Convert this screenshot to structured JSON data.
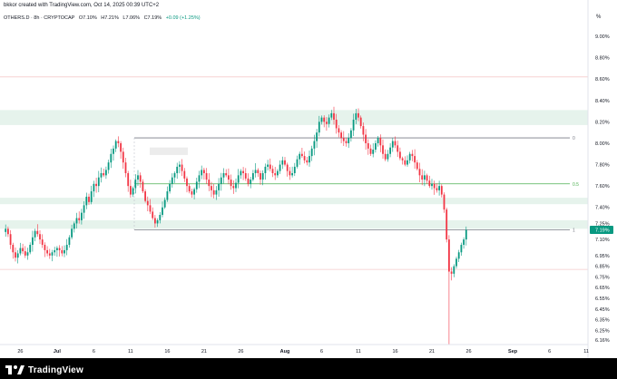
{
  "header": {
    "text": "bkkor created with TradingView.com, Oct 14, 2025 00:39 UTC+2"
  },
  "symbol": {
    "name": "OTHERS.D · 8h · CRYPTOCAP",
    "open": "O7.10%",
    "high": "H7.21%",
    "low": "L7.06%",
    "close": "C7.19%",
    "change": "+0.09 (+1.25%)"
  },
  "axis": {
    "unit": "%"
  },
  "footer": {
    "brand": "TradingView"
  },
  "chart_data": {
    "type": "candlestick",
    "title": "",
    "xlabel": "",
    "ylabel": "",
    "ylim": [
      6.1,
      9.1
    ],
    "y_ticks": [
      "9.00%",
      "8.80%",
      "8.60%",
      "8.40%",
      "8.20%",
      "8.00%",
      "7.80%",
      "7.60%",
      "7.40%",
      "7.25%",
      "7.10%",
      "6.95%",
      "6.85%",
      "6.75%",
      "6.65%",
      "6.55%",
      "6.45%",
      "6.35%",
      "6.25%",
      "6.16%"
    ],
    "current_price_label": "7.19%",
    "x_ticks": [
      "26",
      "Jul",
      "6",
      "11",
      "16",
      "21",
      "26",
      "Aug",
      "6",
      "11",
      "16",
      "21",
      "26",
      "Sep",
      "6",
      "11",
      "16",
      "21",
      "26",
      "Oct",
      "6",
      "11",
      "16",
      "21"
    ],
    "bars_per_day": 3,
    "first_bar_date": "2025-06-24",
    "fib_levels": [
      {
        "label": "0",
        "value": 8.05
      },
      {
        "label": "0.5",
        "value": 7.62
      },
      {
        "label": "1",
        "value": 7.19
      }
    ],
    "zones": [
      {
        "from": 8.17,
        "to": 8.31
      },
      {
        "from": 7.43,
        "to": 7.49
      },
      {
        "from": 7.2,
        "to": 7.28
      }
    ],
    "horizontal_levels": [
      8.62,
      6.82
    ],
    "closes": [
      7.2,
      7.15,
      7.05,
      6.98,
      6.93,
      6.97,
      7.02,
      6.99,
      6.95,
      6.98,
      7.05,
      7.12,
      7.18,
      7.15,
      7.1,
      7.05,
      7.0,
      6.97,
      6.95,
      6.98,
      7.0,
      7.02,
      7.0,
      6.97,
      7.0,
      7.05,
      7.12,
      7.2,
      7.25,
      7.3,
      7.28,
      7.35,
      7.42,
      7.5,
      7.45,
      7.55,
      7.62,
      7.6,
      7.68,
      7.72,
      7.7,
      7.75,
      7.82,
      7.9,
      7.95,
      8.02,
      8.0,
      7.92,
      7.82,
      7.72,
      7.6,
      7.52,
      7.58,
      7.66,
      7.7,
      7.64,
      7.55,
      7.46,
      7.42,
      7.36,
      7.3,
      7.25,
      7.28,
      7.33,
      7.4,
      7.47,
      7.55,
      7.62,
      7.68,
      7.72,
      7.78,
      7.8,
      7.74,
      7.67,
      7.6,
      7.55,
      7.52,
      7.57,
      7.64,
      7.7,
      7.75,
      7.72,
      7.66,
      7.6,
      7.56,
      7.52,
      7.56,
      7.62,
      7.68,
      7.72,
      7.7,
      7.66,
      7.6,
      7.58,
      7.63,
      7.7,
      7.74,
      7.72,
      7.67,
      7.62,
      7.66,
      7.72,
      7.75,
      7.72,
      7.66,
      7.72,
      7.78,
      7.8,
      7.76,
      7.72,
      7.7,
      7.74,
      7.8,
      7.84,
      7.8,
      7.74,
      7.7,
      7.72,
      7.78,
      7.85,
      7.9,
      7.88,
      7.84,
      7.82,
      7.88,
      7.95,
      8.02,
      8.1,
      8.2,
      8.24,
      8.2,
      8.18,
      8.24,
      8.28,
      8.22,
      8.14,
      8.1,
      8.05,
      8.02,
      8.0,
      8.05,
      8.12,
      8.22,
      8.28,
      8.24,
      8.16,
      8.08,
      8.0,
      7.95,
      7.9,
      7.94,
      8.0,
      8.05,
      7.98,
      7.9,
      7.85,
      7.9,
      7.96,
      8.02,
      7.98,
      7.92,
      7.86,
      7.84,
      7.8,
      7.84,
      7.9,
      7.88,
      7.82,
      7.76,
      7.7,
      7.66,
      7.7,
      7.65,
      7.6,
      7.62,
      7.58,
      7.56,
      7.6,
      7.52,
      7.38,
      7.1,
      6.8,
      6.78,
      6.85,
      6.92,
      6.98,
      7.05,
      7.1,
      7.19
    ]
  }
}
